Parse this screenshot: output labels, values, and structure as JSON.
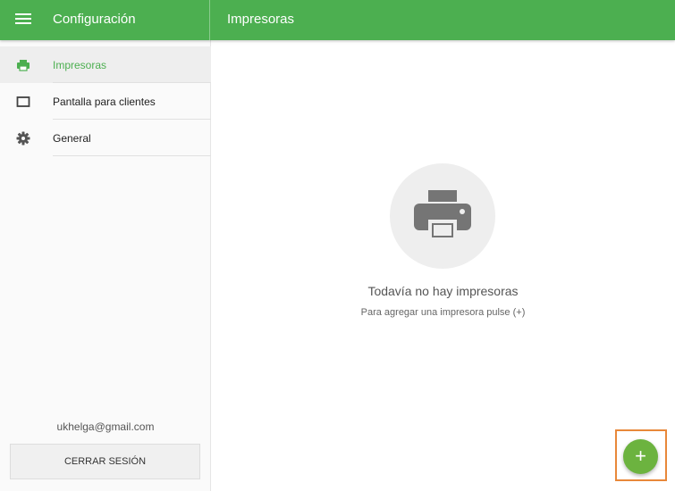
{
  "appbar": {
    "app_title": "Configuración",
    "page_title": "Impresoras",
    "color": "#4caf50",
    "menu_icon": "menu-icon"
  },
  "sidebar": {
    "items": [
      {
        "label": "Impresoras",
        "icon": "printer-icon",
        "active": true
      },
      {
        "label": "Pantalla para clientes",
        "icon": "monitor-icon",
        "active": false
      },
      {
        "label": "General",
        "icon": "gear-icon",
        "active": false
      }
    ],
    "user_email": "ukhelga@gmail.com",
    "logout_label": "CERRAR SESIÓN"
  },
  "main": {
    "empty_icon": "printer-icon",
    "empty_title": "Todavía no hay impresoras",
    "empty_hint": "Para agregar una impresora pulse (+)"
  },
  "fab": {
    "label": "+",
    "color": "#6cb33f",
    "highlight_color": "#e8883a"
  }
}
